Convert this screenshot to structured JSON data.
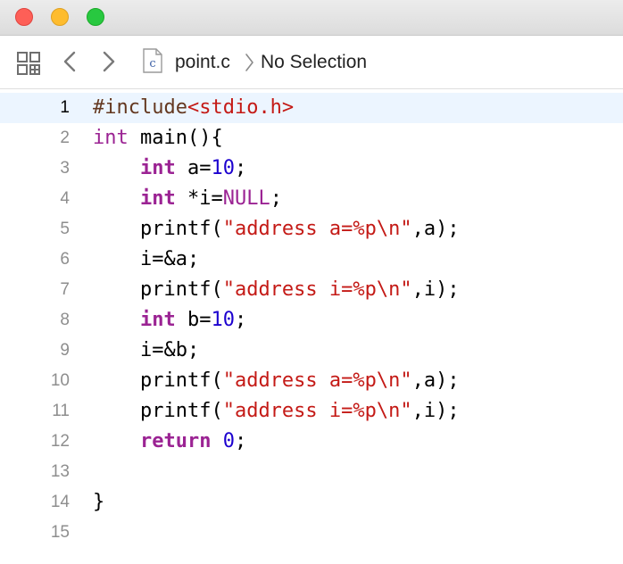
{
  "window": {
    "controls": [
      "close",
      "minimize",
      "zoom"
    ]
  },
  "jumpbar": {
    "file_icon_letter": "c",
    "file_name": "point.c",
    "selection": "No Selection"
  },
  "editor": {
    "current_line": 1,
    "lines": [
      {
        "n": "1",
        "tokens": [
          {
            "t": "#include",
            "c": "pp"
          },
          {
            "t": "<stdio.h>",
            "c": "hdr"
          }
        ]
      },
      {
        "n": "2",
        "tokens": [
          {
            "t": "int",
            "c": "kw"
          },
          {
            "t": " main(){",
            "c": ""
          }
        ]
      },
      {
        "n": "3",
        "tokens": [
          {
            "t": "    ",
            "c": ""
          },
          {
            "t": "int",
            "c": "kwb"
          },
          {
            "t": " a=",
            "c": ""
          },
          {
            "t": "10",
            "c": "num"
          },
          {
            "t": ";",
            "c": ""
          }
        ]
      },
      {
        "n": "4",
        "tokens": [
          {
            "t": "    ",
            "c": ""
          },
          {
            "t": "int",
            "c": "kwb"
          },
          {
            "t": " *i=",
            "c": ""
          },
          {
            "t": "NULL",
            "c": "kw"
          },
          {
            "t": ";",
            "c": ""
          }
        ]
      },
      {
        "n": "5",
        "tokens": [
          {
            "t": "    printf(",
            "c": ""
          },
          {
            "t": "\"address a=%p\\n\"",
            "c": "str"
          },
          {
            "t": ",a);",
            "c": ""
          }
        ]
      },
      {
        "n": "6",
        "tokens": [
          {
            "t": "    i=&a;",
            "c": ""
          }
        ]
      },
      {
        "n": "7",
        "tokens": [
          {
            "t": "    printf(",
            "c": ""
          },
          {
            "t": "\"address i=%p\\n\"",
            "c": "str"
          },
          {
            "t": ",i);",
            "c": ""
          }
        ]
      },
      {
        "n": "8",
        "tokens": [
          {
            "t": "    ",
            "c": ""
          },
          {
            "t": "int",
            "c": "kwb"
          },
          {
            "t": " b=",
            "c": ""
          },
          {
            "t": "10",
            "c": "num"
          },
          {
            "t": ";",
            "c": ""
          }
        ]
      },
      {
        "n": "9",
        "tokens": [
          {
            "t": "    i=&b;",
            "c": ""
          }
        ]
      },
      {
        "n": "10",
        "tokens": [
          {
            "t": "    printf(",
            "c": ""
          },
          {
            "t": "\"address a=%p\\n\"",
            "c": "str"
          },
          {
            "t": ",a);",
            "c": ""
          }
        ]
      },
      {
        "n": "11",
        "tokens": [
          {
            "t": "    printf(",
            "c": ""
          },
          {
            "t": "\"address i=%p\\n\"",
            "c": "str"
          },
          {
            "t": ",i);",
            "c": ""
          }
        ]
      },
      {
        "n": "12",
        "tokens": [
          {
            "t": "    ",
            "c": ""
          },
          {
            "t": "return",
            "c": "kwb"
          },
          {
            "t": " ",
            "c": ""
          },
          {
            "t": "0",
            "c": "num"
          },
          {
            "t": ";",
            "c": ""
          }
        ]
      },
      {
        "n": "13",
        "tokens": []
      },
      {
        "n": "14",
        "tokens": [
          {
            "t": "}",
            "c": ""
          }
        ]
      },
      {
        "n": "15",
        "tokens": []
      }
    ]
  },
  "colors": {
    "keyword": "#9b2393",
    "string": "#c41a16",
    "number": "#1c00cf",
    "preprocessor": "#643820",
    "current_line_bg": "#ecf5ff",
    "close": "#fe5f57",
    "minimize": "#febc2e",
    "zoom": "#28c840"
  },
  "icons": [
    "related-items-grid-icon",
    "back-chevron-icon",
    "forward-chevron-icon",
    "c-file-icon",
    "path-chevron-icon"
  ]
}
